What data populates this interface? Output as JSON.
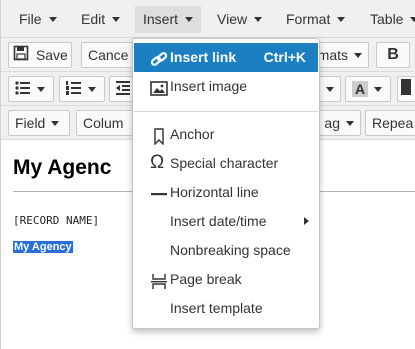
{
  "menubar": {
    "items": [
      {
        "label": "File"
      },
      {
        "label": "Edit"
      },
      {
        "label": "Insert"
      },
      {
        "label": "View"
      },
      {
        "label": "Format"
      },
      {
        "label": "Table"
      }
    ]
  },
  "toolbar1": {
    "save_label": "Save",
    "cancel_label": "Cance",
    "formats_label": "mats",
    "bold_label": "B"
  },
  "toolbar2": {
    "text_color_label": "A"
  },
  "toolbar3": {
    "field_label": "Field",
    "columns_label": "Colum",
    "tag_label": "ag",
    "repeat_label": "Repea"
  },
  "document": {
    "heading": "My Agenc",
    "record_name": "[RECORD NAME]",
    "selected_text": "My Agency"
  },
  "insert_menu": {
    "items": [
      {
        "label": "Insert link",
        "shortcut": "Ctrl+K",
        "icon": "link-icon"
      },
      {
        "label": "Insert image",
        "icon": "image-icon"
      },
      {
        "label": "Anchor",
        "icon": "bookmark-icon"
      },
      {
        "label": "Special character",
        "icon": "omega-icon"
      },
      {
        "label": "Horizontal line",
        "icon": "horizontal-line-icon"
      },
      {
        "label": "Insert date/time",
        "icon": ""
      },
      {
        "label": "Nonbreaking space",
        "icon": ""
      },
      {
        "label": "Page break",
        "icon": "page-break-icon"
      },
      {
        "label": "Insert template",
        "icon": ""
      }
    ]
  },
  "colors": {
    "menu_highlight": "#1c7fc1",
    "selection": "#2a6fd6",
    "toolbar_bg": "#f0f0f0"
  }
}
